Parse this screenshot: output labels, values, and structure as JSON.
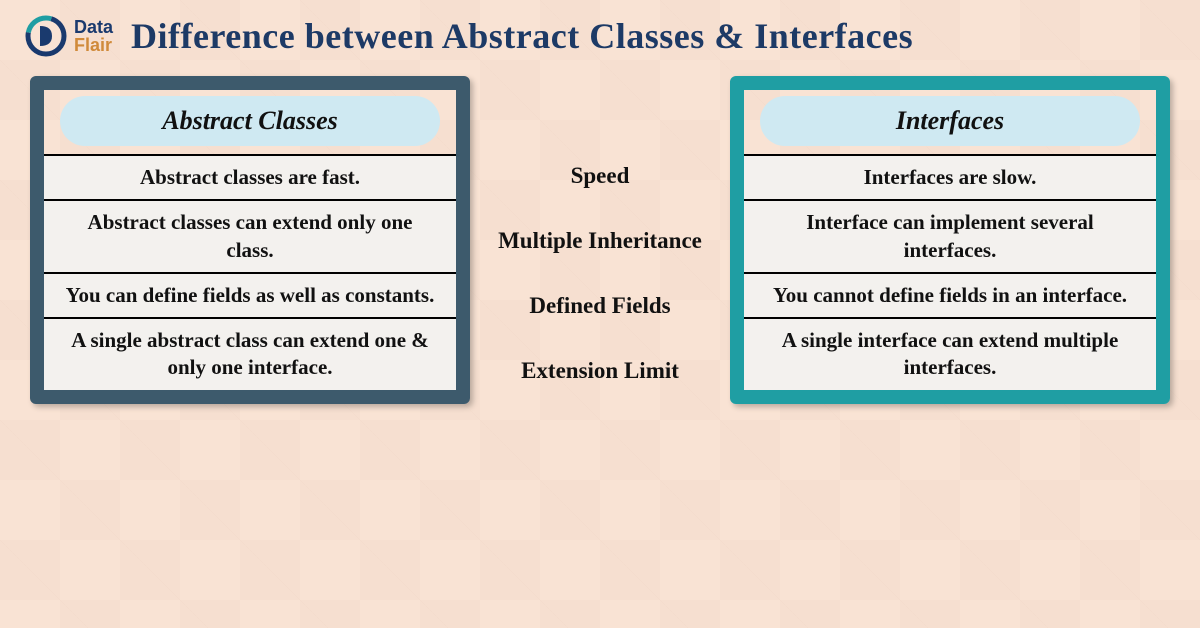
{
  "header": {
    "logo_top": "Data",
    "logo_bottom": "Flair",
    "title": "Difference between Abstract Classes & Interfaces"
  },
  "left_panel": {
    "title": "Abstract Classes",
    "rows": [
      "Abstract classes are fast.",
      "Abstract classes can extend only one class.",
      "You can define fields as well as constants.",
      "A single abstract class can extend one & only one interface."
    ]
  },
  "middle_labels": [
    "Speed",
    "Multiple Inheritance",
    "Defined Fields",
    "Extension Limit"
  ],
  "right_panel": {
    "title": "Interfaces",
    "rows": [
      "Interfaces are slow.",
      "Interface can implement several interfaces.",
      "You cannot define fields in an interface.",
      "A single interface can extend multiple interfaces."
    ]
  }
}
